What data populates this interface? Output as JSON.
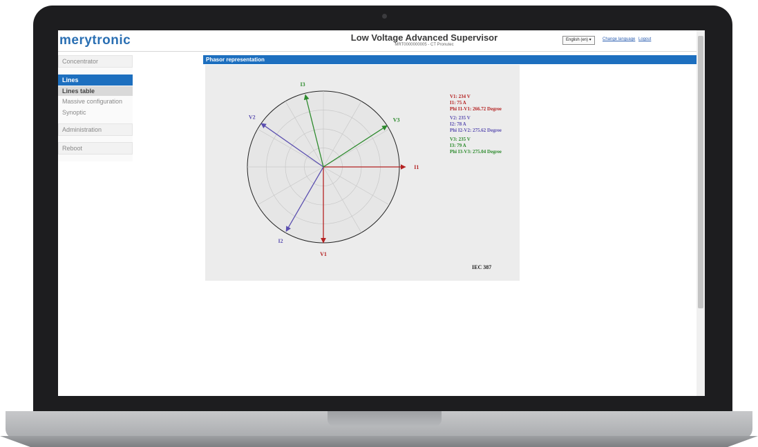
{
  "header": {
    "logo": "merytronic",
    "title": "Low Voltage Advanced Supervisor",
    "subtitle": "MRT0000000005 - CT Pronutec",
    "language_select": "English (en) ▾",
    "change_language_link": "Change language",
    "logout_link": "Logout"
  },
  "sidebar": {
    "concentrator": "Concentrator",
    "lines": "Lines",
    "lines_table": "Lines table",
    "massive_configuration": "Massive configuration",
    "synoptic": "Synoptic",
    "administration": "Administration",
    "reboot": "Reboot"
  },
  "main": {
    "section_title": "Phasor representation",
    "standard": "IEC 387"
  },
  "phasors": [
    {
      "label": "V1",
      "angle_deg": 270,
      "magnitude": 1.0,
      "color": "#b42121"
    },
    {
      "label": "I1",
      "angle_deg": 0,
      "magnitude": 1.0,
      "color": "#b42121"
    },
    {
      "label": "V2",
      "angle_deg": 145,
      "magnitude": 1.0,
      "color": "#5b4fb0"
    },
    {
      "label": "I2",
      "angle_deg": 240,
      "magnitude": 0.98,
      "color": "#5b4fb0"
    },
    {
      "label": "V3",
      "angle_deg": 33,
      "magnitude": 1.0,
      "color": "#2c8a2c"
    },
    {
      "label": "I3",
      "angle_deg": 104,
      "magnitude": 0.98,
      "color": "#2c8a2c"
    }
  ],
  "readings": [
    {
      "color": "#b42121",
      "lines": [
        "V1: 234 V",
        "I1: 75 A",
        "Phi I1-V1: 266.72 Degree"
      ]
    },
    {
      "color": "#5b4fb0",
      "lines": [
        "V2: 235 V",
        "I2: 78 A",
        "Phi I2-V2: 275.62 Degree"
      ]
    },
    {
      "color": "#2c8a2c",
      "lines": [
        "V3: 235 V",
        "I3: 79 A",
        "Phi I3-V3: 275.04 Degree"
      ]
    }
  ]
}
